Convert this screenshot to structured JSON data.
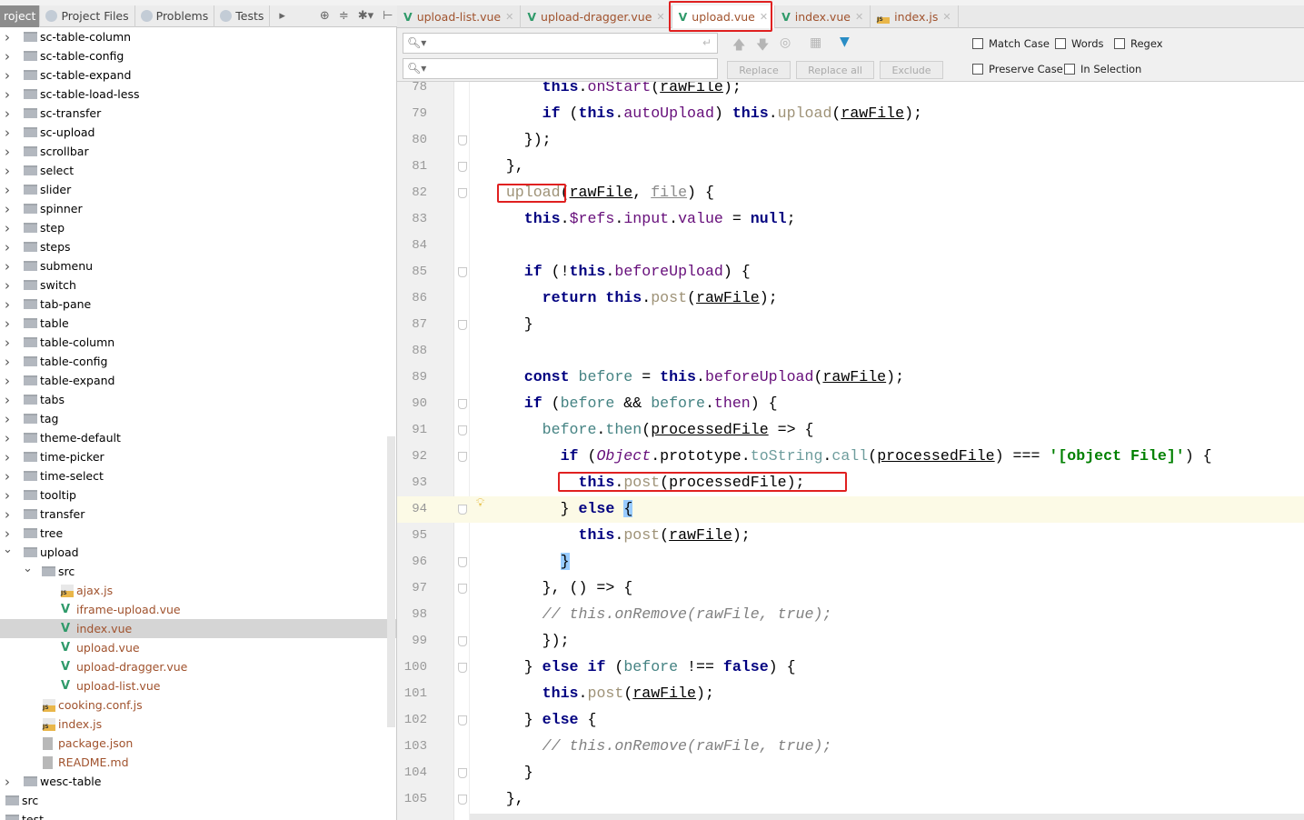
{
  "sidebar_tabs": {
    "project": "roject",
    "project_files": "Project Files",
    "problems": "Problems",
    "tests": "Tests"
  },
  "tree": [
    {
      "label": "sc-table-column",
      "type": "folder",
      "level": 1,
      "expanded": false
    },
    {
      "label": "sc-table-config",
      "type": "folder",
      "level": 1,
      "expanded": false
    },
    {
      "label": "sc-table-expand",
      "type": "folder",
      "level": 1,
      "expanded": false
    },
    {
      "label": "sc-table-load-less",
      "type": "folder",
      "level": 1,
      "expanded": false
    },
    {
      "label": "sc-transfer",
      "type": "folder",
      "level": 1,
      "expanded": false
    },
    {
      "label": "sc-upload",
      "type": "folder",
      "level": 1,
      "expanded": false
    },
    {
      "label": "scrollbar",
      "type": "folder",
      "level": 1,
      "expanded": false
    },
    {
      "label": "select",
      "type": "folder",
      "level": 1,
      "expanded": false
    },
    {
      "label": "slider",
      "type": "folder",
      "level": 1,
      "expanded": false
    },
    {
      "label": "spinner",
      "type": "folder",
      "level": 1,
      "expanded": false
    },
    {
      "label": "step",
      "type": "folder",
      "level": 1,
      "expanded": false
    },
    {
      "label": "steps",
      "type": "folder",
      "level": 1,
      "expanded": false
    },
    {
      "label": "submenu",
      "type": "folder",
      "level": 1,
      "expanded": false
    },
    {
      "label": "switch",
      "type": "folder",
      "level": 1,
      "expanded": false
    },
    {
      "label": "tab-pane",
      "type": "folder",
      "level": 1,
      "expanded": false
    },
    {
      "label": "table",
      "type": "folder",
      "level": 1,
      "expanded": false
    },
    {
      "label": "table-column",
      "type": "folder",
      "level": 1,
      "expanded": false
    },
    {
      "label": "table-config",
      "type": "folder",
      "level": 1,
      "expanded": false
    },
    {
      "label": "table-expand",
      "type": "folder",
      "level": 1,
      "expanded": false
    },
    {
      "label": "tabs",
      "type": "folder",
      "level": 1,
      "expanded": false
    },
    {
      "label": "tag",
      "type": "folder",
      "level": 1,
      "expanded": false
    },
    {
      "label": "theme-default",
      "type": "folder",
      "level": 1,
      "expanded": false
    },
    {
      "label": "time-picker",
      "type": "folder",
      "level": 1,
      "expanded": false
    },
    {
      "label": "time-select",
      "type": "folder",
      "level": 1,
      "expanded": false
    },
    {
      "label": "tooltip",
      "type": "folder",
      "level": 1,
      "expanded": false
    },
    {
      "label": "transfer",
      "type": "folder",
      "level": 1,
      "expanded": false
    },
    {
      "label": "tree",
      "type": "folder",
      "level": 1,
      "expanded": false
    },
    {
      "label": "upload",
      "type": "folder",
      "level": 1,
      "expanded": true
    },
    {
      "label": "src",
      "type": "folder",
      "level": 2,
      "expanded": true
    },
    {
      "label": "ajax.js",
      "type": "js",
      "level": 3
    },
    {
      "label": "iframe-upload.vue",
      "type": "vue",
      "level": 3
    },
    {
      "label": "index.vue",
      "type": "vue",
      "level": 3,
      "selected": true
    },
    {
      "label": "upload.vue",
      "type": "vue",
      "level": 3
    },
    {
      "label": "upload-dragger.vue",
      "type": "vue",
      "level": 3
    },
    {
      "label": "upload-list.vue",
      "type": "vue",
      "level": 3
    },
    {
      "label": "cooking.conf.js",
      "type": "js",
      "level": 2
    },
    {
      "label": "index.js",
      "type": "js",
      "level": 2
    },
    {
      "label": "package.json",
      "type": "json",
      "level": 2
    },
    {
      "label": "README.md",
      "type": "md",
      "level": 2
    },
    {
      "label": "wesc-table",
      "type": "folder",
      "level": 1,
      "expanded": false
    },
    {
      "label": "src",
      "type": "folder",
      "level": 0
    },
    {
      "label": "test",
      "type": "folder",
      "level": 0
    }
  ],
  "editor_tabs": [
    {
      "label": "upload-list.vue",
      "icon": "vue"
    },
    {
      "label": "upload-dragger.vue",
      "icon": "vue"
    },
    {
      "label": "upload.vue",
      "icon": "vue",
      "active": true
    },
    {
      "label": "index.vue",
      "icon": "vue"
    },
    {
      "label": "index.js",
      "icon": "js"
    }
  ],
  "search": {
    "find_value": "",
    "replace_value": "",
    "replace": "Replace",
    "replace_all": "Replace all",
    "exclude": "Exclude",
    "options": {
      "match_case": "Match Case",
      "words": "Words",
      "regex": "Regex",
      "preserve_case": "Preserve Case",
      "in_selection": "In Selection"
    }
  },
  "code": [
    {
      "n": "78",
      "t": [
        [
          "",
          "        "
        ],
        [
          "k",
          "this"
        ],
        [
          "",
          "."
        ],
        [
          "p",
          "onStart"
        ],
        [
          "",
          "("
        ],
        [
          "u",
          "rawFile"
        ],
        [
          "",
          ");"
        ]
      ]
    },
    {
      "n": "79",
      "t": [
        [
          "",
          "        "
        ],
        [
          "k",
          "if"
        ],
        [
          "",
          " ("
        ],
        [
          "k",
          "this"
        ],
        [
          "",
          "."
        ],
        [
          "p",
          "autoUpload"
        ],
        [
          "",
          ") "
        ],
        [
          "k",
          "this"
        ],
        [
          "",
          "."
        ],
        [
          "f",
          "upload"
        ],
        [
          "",
          "("
        ],
        [
          "u",
          "rawFile"
        ],
        [
          "",
          ");"
        ]
      ]
    },
    {
      "n": "80",
      "fold": true,
      "t": [
        [
          "",
          "      });"
        ]
      ]
    },
    {
      "n": "81",
      "fold": true,
      "t": [
        [
          "",
          "    },"
        ]
      ]
    },
    {
      "n": "82",
      "fold": true,
      "t": [
        [
          "",
          "    "
        ],
        [
          "f",
          "upload"
        ],
        [
          "",
          "("
        ],
        [
          "u",
          "rawFile"
        ],
        [
          "",
          ", "
        ],
        [
          "uf",
          "file"
        ],
        [
          "",
          ") {"
        ]
      ]
    },
    {
      "n": "83",
      "t": [
        [
          "",
          "      "
        ],
        [
          "k",
          "this"
        ],
        [
          "",
          "."
        ],
        [
          "p",
          "$refs"
        ],
        [
          "",
          "."
        ],
        [
          "p",
          "input"
        ],
        [
          "",
          "."
        ],
        [
          "p",
          "value"
        ],
        [
          "",
          " = "
        ],
        [
          "k",
          "null"
        ],
        [
          "",
          ";"
        ]
      ]
    },
    {
      "n": "84",
      "t": []
    },
    {
      "n": "85",
      "fold": true,
      "t": [
        [
          "",
          "      "
        ],
        [
          "k",
          "if"
        ],
        [
          "",
          " (!"
        ],
        [
          "k",
          "this"
        ],
        [
          "",
          "."
        ],
        [
          "p",
          "beforeUpload"
        ],
        [
          "",
          ") {"
        ]
      ]
    },
    {
      "n": "86",
      "t": [
        [
          "",
          "        "
        ],
        [
          "k",
          "return"
        ],
        [
          "",
          " "
        ],
        [
          "k",
          "this"
        ],
        [
          "",
          "."
        ],
        [
          "f",
          "post"
        ],
        [
          "",
          "("
        ],
        [
          "u",
          "rawFile"
        ],
        [
          "",
          ");"
        ]
      ]
    },
    {
      "n": "87",
      "fold": true,
      "t": [
        [
          "",
          "      }"
        ]
      ]
    },
    {
      "n": "88",
      "t": []
    },
    {
      "n": "89",
      "t": [
        [
          "",
          "      "
        ],
        [
          "k",
          "const"
        ],
        [
          "",
          " "
        ],
        [
          "l",
          "before"
        ],
        [
          "",
          " = "
        ],
        [
          "k",
          "this"
        ],
        [
          "",
          "."
        ],
        [
          "p",
          "beforeUpload"
        ],
        [
          "",
          "("
        ],
        [
          "u",
          "rawFile"
        ],
        [
          "",
          ");"
        ]
      ]
    },
    {
      "n": "90",
      "fold": true,
      "t": [
        [
          "",
          "      "
        ],
        [
          "k",
          "if"
        ],
        [
          "",
          " ("
        ],
        [
          "l",
          "before"
        ],
        [
          "",
          " && "
        ],
        [
          "l",
          "before"
        ],
        [
          "",
          "."
        ],
        [
          "p",
          "then"
        ],
        [
          "",
          ") {"
        ]
      ]
    },
    {
      "n": "91",
      "fold": true,
      "t": [
        [
          "",
          "        "
        ],
        [
          "l",
          "before"
        ],
        [
          "",
          "."
        ],
        [
          "l",
          "then"
        ],
        [
          "",
          "("
        ],
        [
          "u",
          "processedFile"
        ],
        [
          "",
          " => {"
        ]
      ]
    },
    {
      "n": "92",
      "fold": true,
      "t": [
        [
          "",
          "          "
        ],
        [
          "k",
          "if"
        ],
        [
          "",
          " ("
        ],
        [
          "o",
          "Object"
        ],
        [
          "",
          ".prototype."
        ],
        [
          "m",
          "toString"
        ],
        [
          "",
          "."
        ],
        [
          "m",
          "call"
        ],
        [
          "",
          "("
        ],
        [
          "u",
          "processedFile"
        ],
        [
          "",
          ") === "
        ],
        [
          "s",
          "'[object File]'"
        ],
        [
          "",
          ") {"
        ]
      ]
    },
    {
      "n": "93",
      "t": [
        [
          "",
          "            "
        ],
        [
          "k",
          "this"
        ],
        [
          "",
          "."
        ],
        [
          "f",
          "post"
        ],
        [
          "",
          "(processedFile);"
        ]
      ]
    },
    {
      "n": "94",
      "fold": true,
      "current": true,
      "t": [
        [
          "",
          "          } "
        ],
        [
          "k",
          "else"
        ],
        [
          "",
          " "
        ],
        [
          "b",
          "{"
        ]
      ]
    },
    {
      "n": "95",
      "t": [
        [
          "",
          "            "
        ],
        [
          "k",
          "this"
        ],
        [
          "",
          "."
        ],
        [
          "f",
          "post"
        ],
        [
          "",
          "("
        ],
        [
          "u",
          "rawFile"
        ],
        [
          "",
          ");"
        ]
      ]
    },
    {
      "n": "96",
      "fold": true,
      "t": [
        [
          "",
          "          "
        ],
        [
          "b",
          "}"
        ]
      ]
    },
    {
      "n": "97",
      "fold": true,
      "t": [
        [
          "",
          "        }, () => {"
        ]
      ]
    },
    {
      "n": "98",
      "t": [
        [
          "",
          "        "
        ],
        [
          "c",
          "// this.onRemove(rawFile, true);"
        ]
      ]
    },
    {
      "n": "99",
      "fold": true,
      "t": [
        [
          "",
          "        });"
        ]
      ]
    },
    {
      "n": "100",
      "fold": true,
      "t": [
        [
          "",
          "      } "
        ],
        [
          "k",
          "else"
        ],
        [
          "",
          " "
        ],
        [
          "k",
          "if"
        ],
        [
          "",
          " ("
        ],
        [
          "l",
          "before"
        ],
        [
          "",
          " !== "
        ],
        [
          "k",
          "false"
        ],
        [
          "",
          ") {"
        ]
      ]
    },
    {
      "n": "101",
      "t": [
        [
          "",
          "        "
        ],
        [
          "k",
          "this"
        ],
        [
          "",
          "."
        ],
        [
          "f",
          "post"
        ],
        [
          "",
          "("
        ],
        [
          "u",
          "rawFile"
        ],
        [
          "",
          ");"
        ]
      ]
    },
    {
      "n": "102",
      "fold": true,
      "t": [
        [
          "",
          "      } "
        ],
        [
          "k",
          "else"
        ],
        [
          "",
          " {"
        ]
      ]
    },
    {
      "n": "103",
      "t": [
        [
          "",
          "        "
        ],
        [
          "c",
          "// this.onRemove(rawFile, true);"
        ]
      ]
    },
    {
      "n": "104",
      "fold": true,
      "t": [
        [
          "",
          "      }"
        ]
      ]
    },
    {
      "n": "105",
      "fold": true,
      "t": [
        [
          "",
          "    },"
        ]
      ]
    }
  ],
  "colors": {
    "annotation_red": "#e02020",
    "keyword": "#000080",
    "property": "#660e7a",
    "current_line": "#fcfae6"
  }
}
